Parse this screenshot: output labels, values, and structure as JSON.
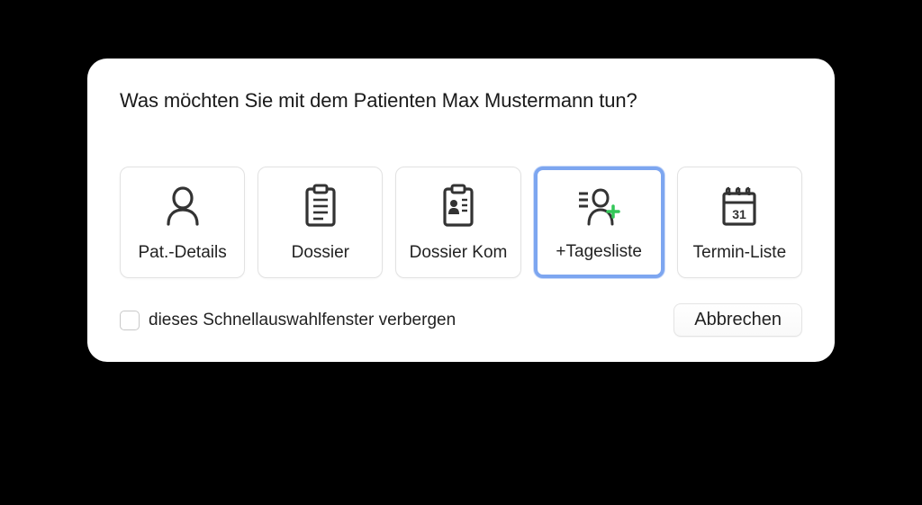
{
  "dialog": {
    "title": "Was möchten Sie mit dem Patienten Max Mustermann tun?",
    "options": [
      {
        "label": "Pat.-Details",
        "selected": false
      },
      {
        "label": "Dossier",
        "selected": false
      },
      {
        "label": "Dossier Kom",
        "selected": false
      },
      {
        "label": "+Tagesliste",
        "selected": true
      },
      {
        "label": "Termin-Liste",
        "selected": false
      }
    ],
    "checkbox": {
      "label": "dieses Schnellauswahlfenster verbergen",
      "checked": false
    },
    "cancel_label": "Abbrechen"
  }
}
